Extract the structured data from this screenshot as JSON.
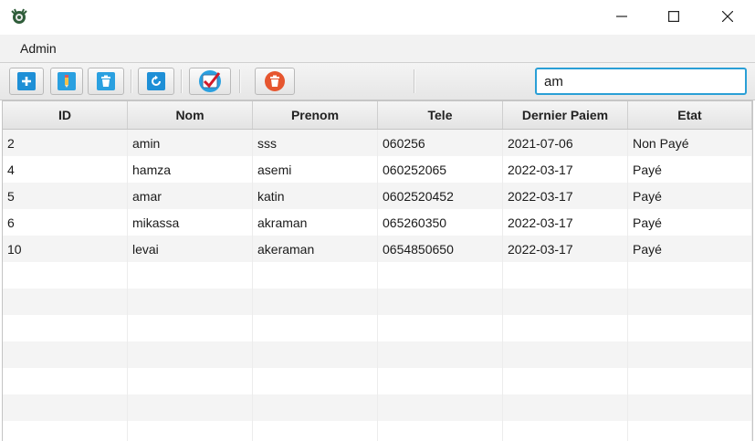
{
  "window": {
    "app_icon": "app-logo-icon",
    "minimize_icon": "minimize-icon",
    "maximize_icon": "maximize-icon",
    "close_icon": "close-icon"
  },
  "menu": {
    "items": [
      {
        "label": "Admin"
      }
    ]
  },
  "toolbar": {
    "buttons": [
      {
        "name": "add-button",
        "icon": "plus-icon",
        "color": "#1e8fd6"
      },
      {
        "name": "edit-button",
        "icon": "pencil-icon",
        "color": "#2aa0e0"
      },
      {
        "name": "delete-button",
        "icon": "trash-icon",
        "color": "#2aa0e0"
      },
      {
        "name": "refresh-button",
        "icon": "refresh-icon",
        "color": "#1e8fd6"
      },
      {
        "name": "validate-payment-button",
        "icon": "checkmark-icon",
        "color": "#d11a2a"
      },
      {
        "name": "remove-all-button",
        "icon": "trash-circle-icon",
        "color": "#e6562f"
      }
    ]
  },
  "search": {
    "value": "am"
  },
  "table": {
    "columns": [
      "ID",
      "Nom",
      "Prenom",
      "Tele",
      "Dernier Paiem",
      "Etat"
    ],
    "rows": [
      [
        "2",
        "amin",
        "sss",
        "060256",
        "2021-07-06",
        "Non Payé"
      ],
      [
        "4",
        "hamza",
        "asemi",
        "060252065",
        "2022-03-17",
        "Payé"
      ],
      [
        "5",
        "amar",
        "katin",
        "0602520452",
        "2022-03-17",
        "Payé"
      ],
      [
        "6",
        "mikassa",
        "akraman",
        "065260350",
        "2022-03-17",
        "Payé"
      ],
      [
        "10",
        "levai",
        "akeraman",
        "0654850650",
        "2022-03-17",
        "Payé"
      ]
    ]
  }
}
